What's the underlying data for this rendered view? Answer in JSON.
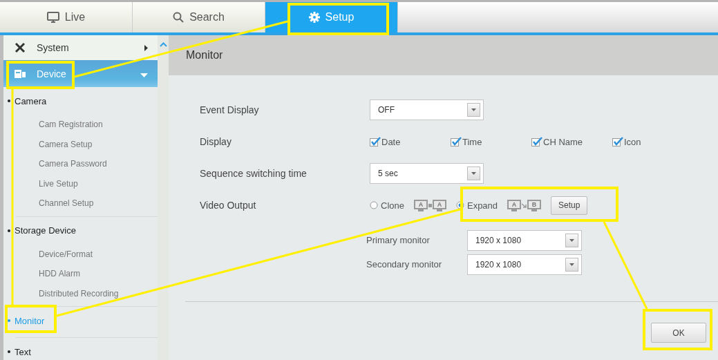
{
  "tabs": [
    {
      "label": "Live",
      "selected": false
    },
    {
      "label": "Search",
      "selected": false
    },
    {
      "label": "Setup",
      "selected": true
    }
  ],
  "sidebar": {
    "menus": [
      {
        "label": "System",
        "selected": false
      },
      {
        "label": "Device",
        "selected": true
      }
    ],
    "tree": [
      {
        "label": "Camera",
        "selected": false,
        "children": [
          {
            "label": "Cam Registration"
          },
          {
            "label": "Camera Setup"
          },
          {
            "label": "Camera Password"
          },
          {
            "label": "Live Setup"
          },
          {
            "label": "Channel Setup"
          }
        ]
      },
      {
        "label": "Storage Device",
        "selected": false,
        "children": [
          {
            "label": "Device/Format"
          },
          {
            "label": "HDD Alarm"
          },
          {
            "label": "Distributed Recording"
          }
        ]
      },
      {
        "label": "Monitor",
        "selected": true
      },
      {
        "label": "Text",
        "selected": false
      }
    ]
  },
  "page_title": "Monitor",
  "form": [
    {
      "kind": "select",
      "label": "Event Display",
      "value": "OFF"
    },
    {
      "kind": "checks",
      "label": "Display",
      "options": [
        {
          "label": "Date",
          "checked": true
        },
        {
          "label": "Time",
          "checked": true
        },
        {
          "label": "CH Name",
          "checked": true
        },
        {
          "label": "Icon",
          "checked": true
        }
      ]
    },
    {
      "kind": "select",
      "label": "Sequence switching time",
      "value": "5 sec"
    },
    {
      "kind": "video_output",
      "label": "Video Output",
      "options": [
        {
          "kind": "clone",
          "label": "Clone",
          "selected": false,
          "screens": [
            "A",
            "A"
          ]
        },
        {
          "kind": "expand",
          "label": "Expand",
          "selected": true,
          "screens": [
            "A",
            "B"
          ]
        }
      ],
      "button": "Setup",
      "monitors": [
        {
          "label": "Primary monitor",
          "value": "1920 x 1080"
        },
        {
          "label": "Secondary monitor",
          "value": "1920 x 1080"
        }
      ]
    }
  ],
  "ok_button": "OK"
}
